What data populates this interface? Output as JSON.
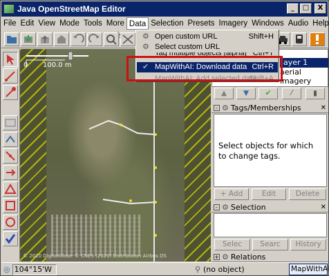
{
  "window": {
    "title": "Java OpenStreetMap Editor",
    "minimize": "_",
    "maximize": "□",
    "close": "X"
  },
  "menubar": [
    "File",
    "Edit",
    "View",
    "Mode",
    "Tools",
    "More tools",
    "Data",
    "Selection",
    "Presets",
    "Imagery",
    "Windows",
    "Audio",
    "Help"
  ],
  "active_menu": "Data",
  "data_menu": {
    "items": [
      {
        "label": "Open custom URL",
        "shortcut": "Shift+H"
      },
      {
        "label": "Select custom URL",
        "shortcut": ""
      },
      {
        "label": "Tag multiple objects [alpha]",
        "shortcut": "Ctrl+T"
      },
      {
        "label": "MapWithAI: Download data",
        "shortcut": "Ctrl+R"
      },
      {
        "label": "MapWithAI: Add selected data",
        "shortcut": "Shift+A"
      }
    ],
    "highlighted_index": 3
  },
  "map": {
    "scale_left": "0",
    "scale_right": "100.0 m",
    "attribution": "© 2020 DigitalGlobe © CNES (2020) Distribution Airbus DS"
  },
  "layers_panel": {
    "items": [
      "layer 1",
      "aerial imagery"
    ]
  },
  "tags_panel": {
    "title": "Tags/Memberships",
    "empty_message": "Select objects for which to change tags.",
    "add": "+ Add",
    "edit": "Edit",
    "delete": "Delete"
  },
  "selection_panel": {
    "title": "Selection",
    "select": "Selec",
    "search": "Searc",
    "history": "History"
  },
  "relations_panel": {
    "title": "Relations"
  },
  "statusbar": {
    "longitude": "104°15'W",
    "object": "(no object)",
    "plugin": "MapWithAI"
  },
  "colors": {
    "titlebar": "#0a246a",
    "highlight_box": "#cc1010",
    "menu_selected": "#0a246a",
    "map_hatch": "#dcd200"
  }
}
